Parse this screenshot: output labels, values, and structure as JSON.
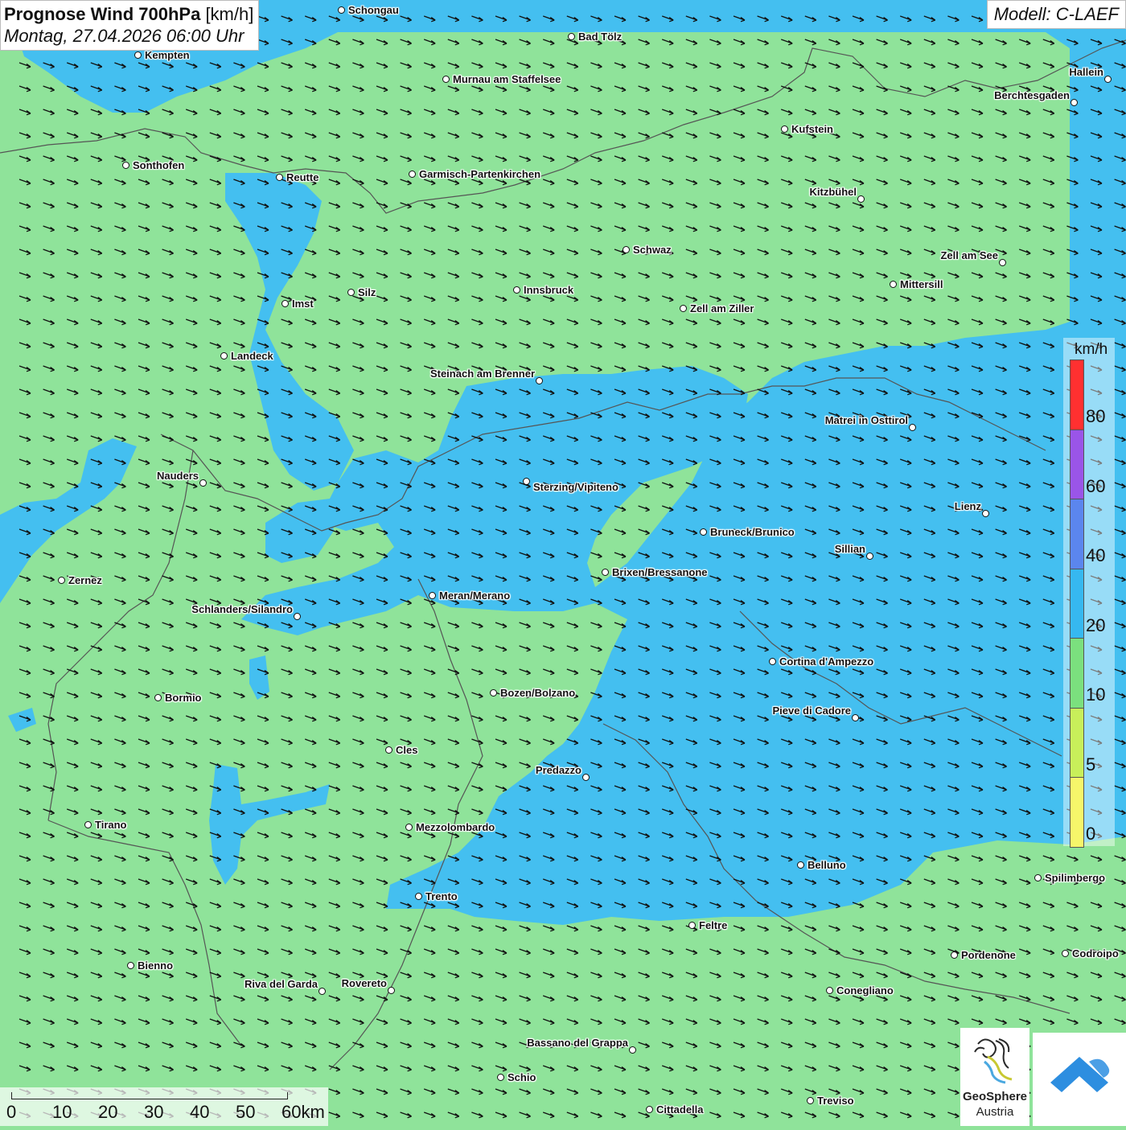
{
  "title": {
    "main_bold": "Prognose Wind 700hPa",
    "main_unit": "[km/h]",
    "datetime": "Montag, 27.04.2026 06:00 Uhr"
  },
  "model": "Modell: C-LAEF",
  "colors": {
    "wind_5_10": "#8fe39a",
    "wind_10_20": "#44bff0",
    "land_border": "#555555"
  },
  "legend": {
    "unit": "km/h",
    "labels": [
      "80",
      "60",
      "40",
      "20",
      "10",
      "5",
      "0"
    ],
    "colors": [
      "#ff3030",
      "#9a55e8",
      "#5b86ee",
      "#36b8f0",
      "#7be07e",
      "#c8ef5a",
      "#f6f66a"
    ]
  },
  "scale": {
    "labels": [
      "0",
      "10",
      "20",
      "30",
      "40",
      "50",
      "60km"
    ]
  },
  "cities": [
    {
      "name": "Schongau"
    },
    {
      "name": "Bad Tölz"
    },
    {
      "name": "Kempten"
    },
    {
      "name": "Murnau am Staffelsee"
    },
    {
      "name": "Hallein"
    },
    {
      "name": "Berchtesgaden"
    },
    {
      "name": "Kufstein"
    },
    {
      "name": "Sonthofen"
    },
    {
      "name": "Reutte"
    },
    {
      "name": "Garmisch-Partenkirchen"
    },
    {
      "name": "Kitzbühel"
    },
    {
      "name": "Schwaz"
    },
    {
      "name": "Zell am See"
    },
    {
      "name": "Mittersill"
    },
    {
      "name": "Innsbruck"
    },
    {
      "name": "Silz"
    },
    {
      "name": "Imst"
    },
    {
      "name": "Zell am Ziller"
    },
    {
      "name": "Landeck"
    },
    {
      "name": "Steinach am Brenner"
    },
    {
      "name": "Matrei in Osttirol"
    },
    {
      "name": "Nauders"
    },
    {
      "name": "Sterzing/Vipiteno"
    },
    {
      "name": "Lienz"
    },
    {
      "name": "Bruneck/Brunico"
    },
    {
      "name": "Sillian"
    },
    {
      "name": "Zernez"
    },
    {
      "name": "Brixen/Bressanone"
    },
    {
      "name": "Meran/Merano"
    },
    {
      "name": "Schlanders/Silandro"
    },
    {
      "name": "Cortina d'Ampezzo"
    },
    {
      "name": "Bozen/Bolzano"
    },
    {
      "name": "Bormio"
    },
    {
      "name": "Pieve di Cadore"
    },
    {
      "name": "Cles"
    },
    {
      "name": "Predazzo"
    },
    {
      "name": "Tirano"
    },
    {
      "name": "Mezzolombardo"
    },
    {
      "name": "Belluno"
    },
    {
      "name": "Spilimbergo"
    },
    {
      "name": "Trento"
    },
    {
      "name": "Feltre"
    },
    {
      "name": "Pordenone"
    },
    {
      "name": "Codroipo"
    },
    {
      "name": "Bienno"
    },
    {
      "name": "Riva del Garda"
    },
    {
      "name": "Rovereto"
    },
    {
      "name": "Conegliano"
    },
    {
      "name": "Bassano del Grappa"
    },
    {
      "name": "Schio"
    },
    {
      "name": "Treviso"
    },
    {
      "name": "Cittadella"
    }
  ],
  "logo": {
    "line1": "GeoSphere",
    "line2": "Austria"
  }
}
